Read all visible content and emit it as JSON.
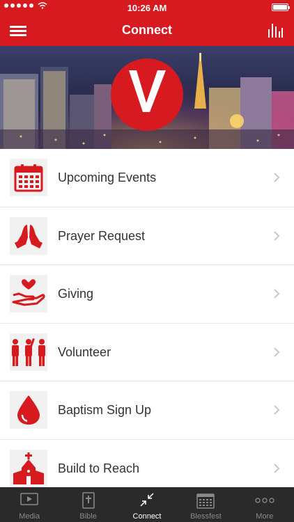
{
  "status_bar": {
    "time": "10:26 AM"
  },
  "header": {
    "title": "Connect"
  },
  "menu_items": [
    {
      "label": "Upcoming Events",
      "icon": "calendar-icon"
    },
    {
      "label": "Prayer Request",
      "icon": "praying-hands-icon"
    },
    {
      "label": "Giving",
      "icon": "heart-hand-icon"
    },
    {
      "label": "Volunteer",
      "icon": "people-icon"
    },
    {
      "label": "Baptism Sign Up",
      "icon": "water-drop-icon"
    },
    {
      "label": "Build to Reach",
      "icon": "church-icon"
    }
  ],
  "tabs": [
    {
      "label": "Media",
      "icon": "play-icon",
      "active": false
    },
    {
      "label": "Bible",
      "icon": "bible-icon",
      "active": false
    },
    {
      "label": "Connect",
      "icon": "connect-icon",
      "active": true
    },
    {
      "label": "Blessfest",
      "icon": "calendar-icon",
      "active": false
    },
    {
      "label": "More",
      "icon": "more-icon",
      "active": false
    }
  ],
  "colors": {
    "brand_red": "#d71920",
    "tab_bar": "#2a2a2a"
  }
}
